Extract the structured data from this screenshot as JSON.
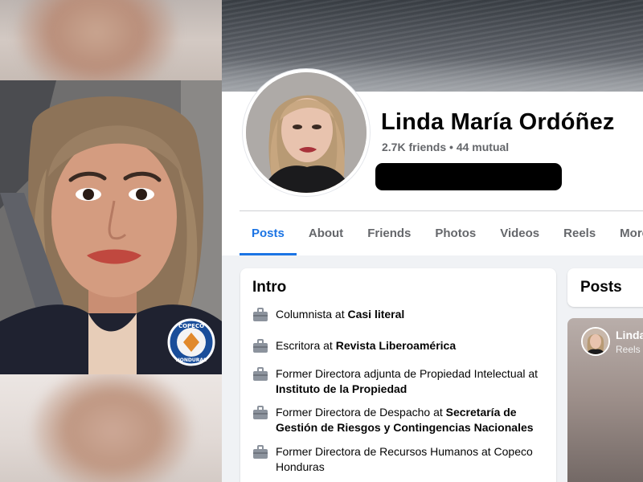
{
  "profile": {
    "name": "Linda María Ordóñez",
    "friends_line": "2.7K friends • 44 mutual"
  },
  "tabs": [
    {
      "label": "Posts",
      "active": true
    },
    {
      "label": "About",
      "active": false
    },
    {
      "label": "Friends",
      "active": false
    },
    {
      "label": "Photos",
      "active": false
    },
    {
      "label": "Videos",
      "active": false
    },
    {
      "label": "Reels",
      "active": false
    },
    {
      "label": "More",
      "active": false
    }
  ],
  "intro": {
    "title": "Intro",
    "items": [
      {
        "prefix": "Columnista at ",
        "org": "Casi literal",
        "icon": "briefcase-icon"
      },
      {
        "prefix": "Escritora at ",
        "org": "Revista Liberoamérica",
        "icon": "briefcase-icon"
      },
      {
        "prefix": "Former Directora adjunta de Propiedad Intelectual at ",
        "org": "Instituto de la Propiedad",
        "icon": "briefcase-icon"
      },
      {
        "prefix": "Former Directora de Despacho at ",
        "org": "Secretaría de Gestión de Riesgos y Contingencias Nacionales",
        "icon": "briefcase-icon"
      },
      {
        "prefix": "Former Directora de Recursos Humanos at Copeco Honduras",
        "org": "",
        "icon": "briefcase-icon"
      }
    ]
  },
  "posts": {
    "title": "Posts",
    "reel_author": "Linda",
    "reel_sub": "Reels ·"
  },
  "badge": {
    "line1": "COPECO",
    "line2": "HONDURAS"
  },
  "colors": {
    "accent": "#1b74e4",
    "secondary_text": "#65676b",
    "page_bg": "#f0f2f5"
  }
}
